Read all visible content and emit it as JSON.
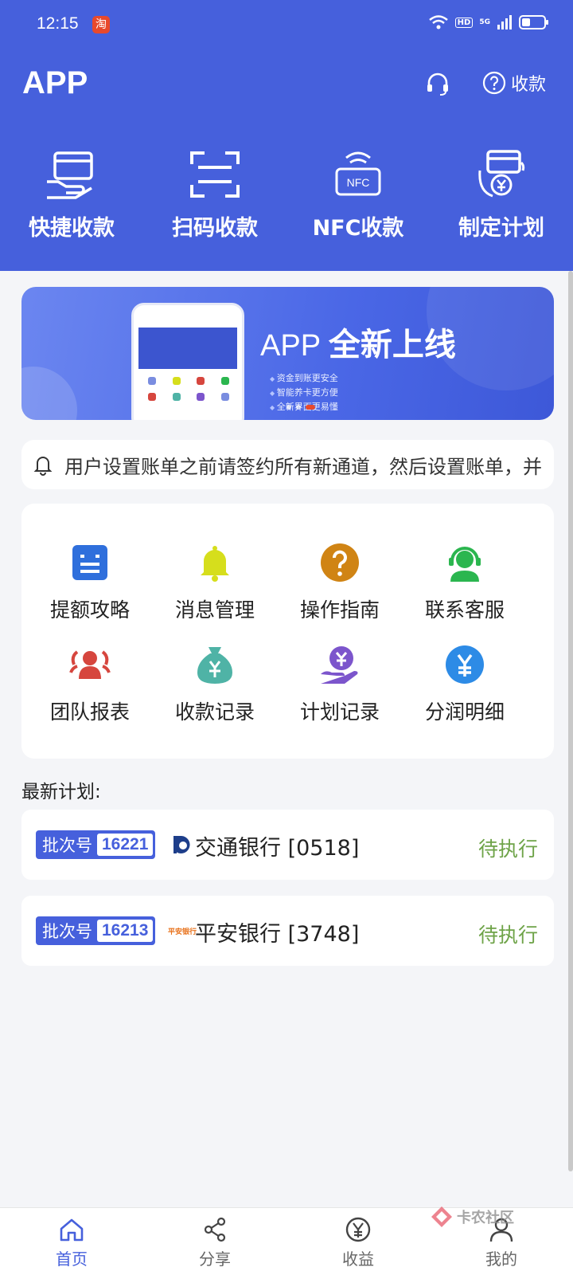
{
  "status_bar": {
    "time": "12:15",
    "taobao": "淘",
    "network": "5G",
    "hd": "HD"
  },
  "header": {
    "title": "APP",
    "collect_label": "收款"
  },
  "quick_actions": [
    {
      "label": "快捷收款",
      "icon": "card-hand-icon"
    },
    {
      "label": "扫码收款",
      "icon": "scan-icon"
    },
    {
      "label": "NFC收款",
      "icon": "nfc-icon"
    },
    {
      "label": "制定计划",
      "icon": "plan-cycle-icon"
    }
  ],
  "nfc_text": "NFC",
  "banner": {
    "head_plain": "APP",
    "head_bold": "全新上线",
    "bullets": [
      "资金到账更安全",
      "智能养卡更方便",
      "全新界面更易懂"
    ]
  },
  "notice": {
    "text": "用户设置账单之前请签约所有新通道，然后设置账单，并"
  },
  "features": [
    {
      "label": "提额攻略",
      "icon": "document-icon",
      "color": "#2f6fdc"
    },
    {
      "label": "消息管理",
      "icon": "bell-icon",
      "color": "#d6de1c"
    },
    {
      "label": "操作指南",
      "icon": "question-icon",
      "color": "#d08414"
    },
    {
      "label": "联系客服",
      "icon": "support-agent-icon",
      "color": "#2bb64f"
    },
    {
      "label": "团队报表",
      "icon": "team-icon",
      "color": "#d6463e"
    },
    {
      "label": "收款记录",
      "icon": "money-bag-icon",
      "color": "#4fb3a6"
    },
    {
      "label": "计划记录",
      "icon": "hand-coin-icon",
      "color": "#7c55cc"
    },
    {
      "label": "分润明细",
      "icon": "yuan-circle-icon",
      "color": "#2d8be6"
    }
  ],
  "section": {
    "title": "最新计划:"
  },
  "plans": [
    {
      "batch_label": "批次号",
      "batch_no": "16221",
      "bank": "交通银行 [0518]",
      "status": "待执行",
      "logo": "bocom-logo-icon"
    },
    {
      "batch_label": "批次号",
      "batch_no": "16213",
      "bank": "平安银行 [3748]",
      "status": "待执行",
      "logo": "pingan-logo-icon",
      "logo_text": "平安银行"
    }
  ],
  "tabs": [
    {
      "label": "首页",
      "icon": "home-icon",
      "active": true
    },
    {
      "label": "分享",
      "icon": "share-icon",
      "active": false
    },
    {
      "label": "收益",
      "icon": "yuan-icon",
      "active": false
    },
    {
      "label": "我的",
      "icon": "user-icon",
      "active": false
    }
  ],
  "watermark": {
    "text": "卡农社区"
  },
  "colors": {
    "primary": "#4660dc",
    "status_pending": "#6ea348"
  }
}
